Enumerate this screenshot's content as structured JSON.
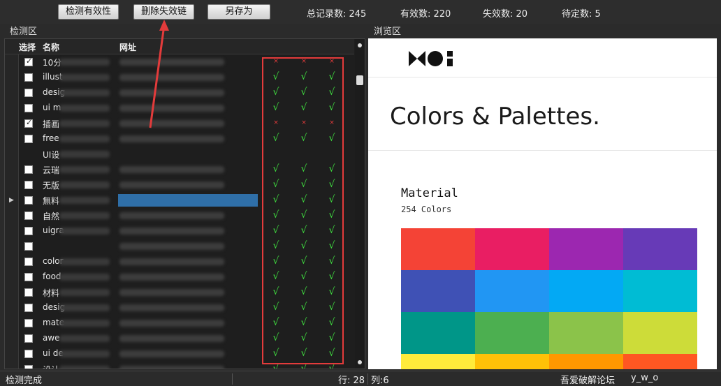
{
  "toolbar": {
    "check_label": "检测有效性",
    "delete_label": "删除失效链",
    "saveas_label": "另存为",
    "total": "总记录数: 245",
    "valid": "有效数: 220",
    "invalid": "失效数: 20",
    "pending": "待定数: 5"
  },
  "sections": {
    "detect": "检测区",
    "browse": "浏览区"
  },
  "grid": {
    "col_select": "选择",
    "col_name": "名称",
    "col_url": "网址",
    "rows": [
      {
        "checked": true,
        "name": "10分",
        "marks": [
          "×",
          "×",
          "×"
        ]
      },
      {
        "checked": false,
        "name": "illust",
        "marks": [
          "√",
          "√",
          "√"
        ]
      },
      {
        "checked": false,
        "name": "desig",
        "marks": [
          "√",
          "√",
          "√"
        ]
      },
      {
        "checked": false,
        "name": "ui m",
        "marks": [
          "√",
          "√",
          "√"
        ]
      },
      {
        "checked": true,
        "name": "插画",
        "marks": [
          "×",
          "×",
          "×"
        ]
      },
      {
        "checked": false,
        "name": "free",
        "marks": [
          "√",
          "√",
          "√"
        ]
      },
      {
        "checked": null,
        "name": "UI设",
        "marks": [
          "",
          "",
          ""
        ]
      },
      {
        "checked": false,
        "name": "云瑞",
        "marks": [
          "√",
          "√",
          "√"
        ]
      },
      {
        "checked": false,
        "name": "无版",
        "marks": [
          "√",
          "√",
          "√"
        ]
      },
      {
        "checked": false,
        "name": "無料",
        "marks": [
          "√",
          "√",
          "√"
        ],
        "selected": true
      },
      {
        "checked": false,
        "name": "自然",
        "marks": [
          "√",
          "√",
          "√"
        ]
      },
      {
        "checked": false,
        "name": "uigra",
        "marks": [
          "√",
          "√",
          "√"
        ]
      },
      {
        "checked": false,
        "name": "",
        "marks": [
          "√",
          "√",
          "√"
        ]
      },
      {
        "checked": false,
        "name": "color",
        "marks": [
          "√",
          "√",
          "√"
        ]
      },
      {
        "checked": false,
        "name": "food",
        "marks": [
          "√",
          "√",
          "√"
        ]
      },
      {
        "checked": false,
        "name": "材料",
        "marks": [
          "√",
          "√",
          "√"
        ]
      },
      {
        "checked": false,
        "name": "desig",
        "marks": [
          "√",
          "√",
          "√"
        ]
      },
      {
        "checked": false,
        "name": "mate",
        "marks": [
          "√",
          "√",
          "√"
        ]
      },
      {
        "checked": false,
        "name": "awe",
        "marks": [
          "√",
          "√",
          "√"
        ]
      },
      {
        "checked": false,
        "name": "ui de",
        "marks": [
          "√",
          "√",
          "√"
        ]
      },
      {
        "checked": false,
        "name": "设计",
        "marks": [
          "√",
          "√",
          "√"
        ]
      }
    ]
  },
  "browser": {
    "logo": "MUI",
    "title": "Colors & Palettes.",
    "palette_name": "Material",
    "palette_count": "254 Colors",
    "swatches": [
      "#f44336",
      "#e91e63",
      "#9c27b0",
      "#673ab7",
      "#3f51b5",
      "#2196f3",
      "#03a9f4",
      "#00bcd4",
      "#009688",
      "#4caf50",
      "#8bc34a",
      "#cddc39",
      "#ffeb3b",
      "#ffc107",
      "#ff9800",
      "#ff5722"
    ]
  },
  "status": {
    "left": "检测完成",
    "row": "行: 28",
    "col": "列:6",
    "forum": "吾爱破解论坛",
    "user": "y_w_o"
  }
}
